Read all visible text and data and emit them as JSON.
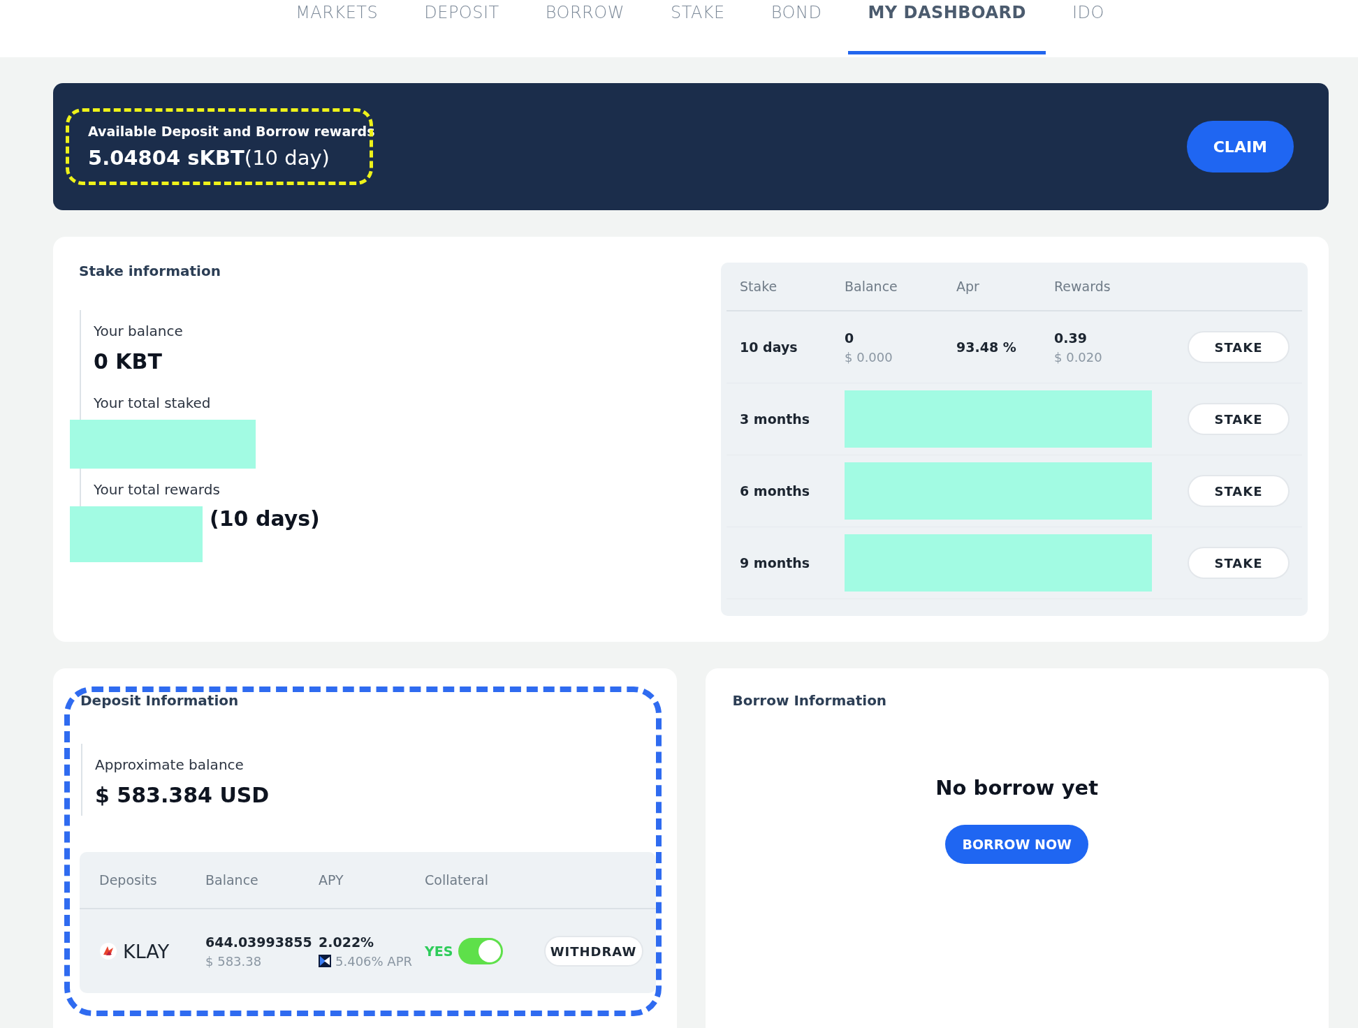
{
  "nav": {
    "tabs": [
      {
        "label": "MARKETS",
        "selected": false
      },
      {
        "label": "DEPOSIT",
        "selected": false
      },
      {
        "label": "BORROW",
        "selected": false
      },
      {
        "label": "STAKE",
        "selected": false
      },
      {
        "label": "BOND",
        "selected": false
      },
      {
        "label": "MY DASHBOARD",
        "selected": true
      },
      {
        "label": "IDO",
        "selected": false
      }
    ]
  },
  "rewards_banner": {
    "label": "Available Deposit and Borrow rewards",
    "amount": "**5.04804 sKBT**(10 day)",
    "button": "CLAIM"
  },
  "stake_information": {
    "title": "Stake information",
    "items": [
      {
        "label": "Your balance",
        "value": "0 KBT",
        "redacted": false
      },
      {
        "label": "Your total staked",
        "redacted": true
      },
      {
        "label": "Your total rewards",
        "value": "(10 days)",
        "redacted": true
      }
    ],
    "table": {
      "columns": [
        "Stake",
        "Balance",
        "Apr",
        "Rewards"
      ],
      "rows": [
        {
          "kind": "full",
          "stake": "10 days",
          "balance": "0",
          "balance_usd": "$ 0.000",
          "apr": "93.48 %",
          "rewards": "0.39",
          "rewards_usd": "$ 0.020",
          "button": "STAKE"
        },
        {
          "kind": "redacted",
          "stake": "3 months",
          "button": "STAKE"
        },
        {
          "kind": "redacted",
          "stake": "6 months",
          "button": "STAKE"
        },
        {
          "kind": "redacted",
          "stake": "9 months",
          "button": "STAKE"
        }
      ]
    }
  },
  "deposit_information": {
    "title": "Deposit Information",
    "balance_label": "Approximate balance",
    "balance": "$ 583.384 USD",
    "table": {
      "columns": [
        "Deposits",
        "Balance",
        "APY",
        "Collateral"
      ],
      "rows": [
        {
          "asset": "KLAY",
          "balance": "644.03993855",
          "balance_usd": "$ 583.38",
          "apy": "2.022%",
          "apr": "5.406% APR",
          "collateral_label": "YES",
          "collateral": true,
          "button": "WITHDRAW"
        }
      ]
    }
  },
  "borrow_information": {
    "title": "Borrow Information",
    "empty_text": "No borrow yet",
    "button": "BORROW NOW"
  }
}
